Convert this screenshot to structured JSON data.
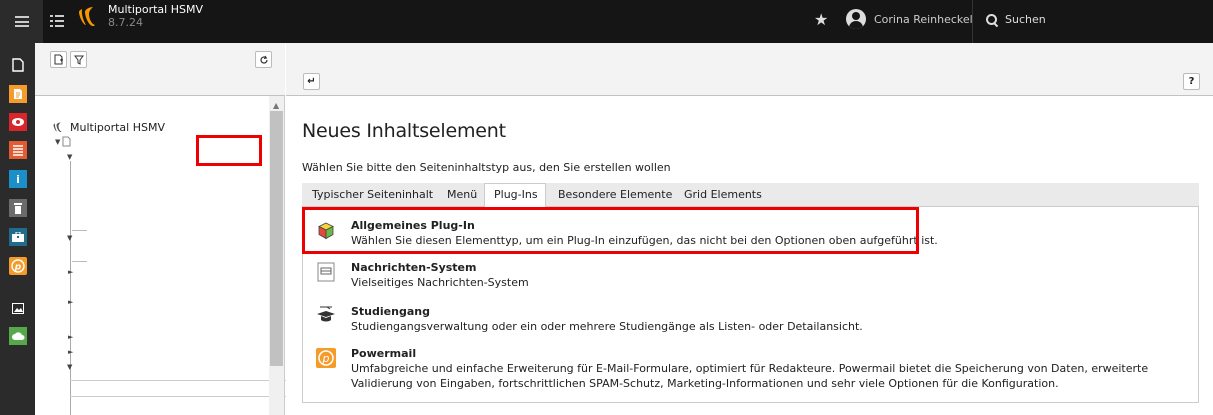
{
  "topbar": {
    "site_name": "Multiportal HSMV",
    "version": "8.7.24",
    "user_name": "Corina Reinheckel",
    "search_label": "Suchen"
  },
  "modules": [
    {
      "name": "page",
      "color": "#2b2b2b",
      "icon": "page-icon"
    },
    {
      "name": "list",
      "color": "#f49b2a",
      "icon": "list-icon"
    },
    {
      "name": "view",
      "color": "#d9262b",
      "icon": "eye-icon"
    },
    {
      "name": "web",
      "color": "#e25b32",
      "icon": "web-list-icon"
    },
    {
      "name": "info",
      "color": "#1b8fc8",
      "icon": "info-icon"
    },
    {
      "name": "recycler",
      "color": "#6b6b6b",
      "icon": "trash-icon"
    },
    {
      "name": "workspaces",
      "color": "#1d6d8b",
      "icon": "briefcase-icon"
    },
    {
      "name": "powermail",
      "color": "#f49b2a",
      "icon": "powermail-icon"
    },
    {
      "name": "filelist",
      "color": "#2b2b2b",
      "icon": "image-icon"
    },
    {
      "name": "cloud",
      "color": "#57a84a",
      "icon": "cloud-icon"
    }
  ],
  "tree": {
    "root_label": "Multiportal HSMV"
  },
  "content": {
    "title": "Neues Inhaltselement",
    "subtitle": "Wählen Sie bitte den Seiteninhaltstyp aus, den Sie erstellen wollen",
    "tabs": [
      {
        "label": "Typischer Seiteninhalt"
      },
      {
        "label": "Menü"
      },
      {
        "label": "Plug-Ins",
        "active": true
      },
      {
        "label": "Besondere Elemente"
      },
      {
        "label": "Grid Elements"
      }
    ],
    "items": [
      {
        "title": "Allgemeines Plug-In",
        "description": "Wählen Sie diesen Elementtyp, um ein Plug-In einzufügen, das nicht bei den Optionen oben aufgeführt ist.",
        "icon": "cube-icon"
      },
      {
        "title": "Nachrichten-System",
        "description": "Vielseitiges Nachrichten-System",
        "icon": "news-icon"
      },
      {
        "title": "Studiengang",
        "description": "Studiengangsverwaltung oder ein oder mehrere Studiengänge als Listen- oder Detailansicht.",
        "icon": "graduation-cap-icon"
      },
      {
        "title": "Powermail",
        "description": "Umfabgreiche und einfache Erweiterung für E-Mail-Formulare, optimiert für Redakteure. Powermail bietet die Speicherung von Daten, erweiterte Validierung von Eingaben, fortschrittlichen SPAM-Schutz, Marketing-Informationen und sehr viele Optionen für die Konfiguration.",
        "icon": "powermail-icon"
      }
    ]
  },
  "colors": {
    "topbar": "#151515",
    "highlight": "#ee0000"
  }
}
